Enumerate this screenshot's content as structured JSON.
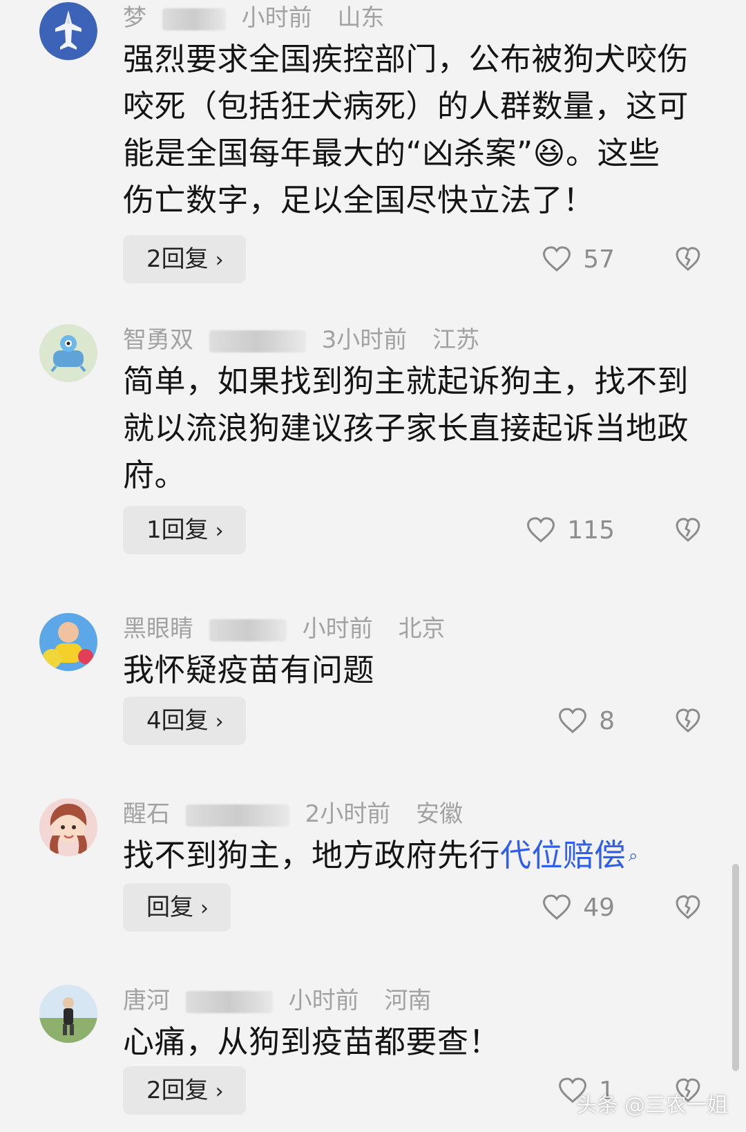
{
  "comments": [
    {
      "author": "梦",
      "time": "小时前",
      "location": "山东",
      "text": "强烈要求全国疾控部门，公布被狗犬咬伤咬死（包括狂犬病死）的人群数量，这可能是全国每年最大的“凶杀案”😆。这些伤亡数字，足以全国尽快立法了！",
      "reply_label": "2回复",
      "likes": "57",
      "avatar_icon": "fighter-jet-avatar"
    },
    {
      "author": "智勇双",
      "time": "3小时前",
      "location": "江苏",
      "text": "简单，如果找到狗主就起诉狗主，找不到就以流浪狗建议孩子家长直接起诉当地政府。",
      "reply_label": "1回复",
      "likes": "115",
      "avatar_icon": "robot-avatar"
    },
    {
      "author": "黑眼睛",
      "time": "小时前",
      "location": "北京",
      "text": "我怀疑疫苗有问题",
      "reply_label": "4回复",
      "likes": "8",
      "avatar_icon": "child-photo-avatar"
    },
    {
      "author": "醒石",
      "time": "2小时前",
      "location": "安徽",
      "text_prefix": "找不到狗主，地方政府先行",
      "text_link": "代位赔偿",
      "search_icon": "search-icon",
      "reply_label": "回复",
      "likes": "49",
      "avatar_icon": "anime-girl-avatar"
    },
    {
      "author": "唐河",
      "time": "小时前",
      "location": "河南",
      "text": "心痛，从狗到疫苗都要查！",
      "reply_label": "2回复",
      "likes": "1",
      "avatar_icon": "man-outdoor-avatar"
    }
  ],
  "ui": {
    "reply_chevron": "›",
    "like_icon": "heart-outline-icon",
    "dislike_icon": "broken-heart-icon",
    "scrollbar": "scrollbar"
  },
  "watermark": "头条 @三农一姐"
}
